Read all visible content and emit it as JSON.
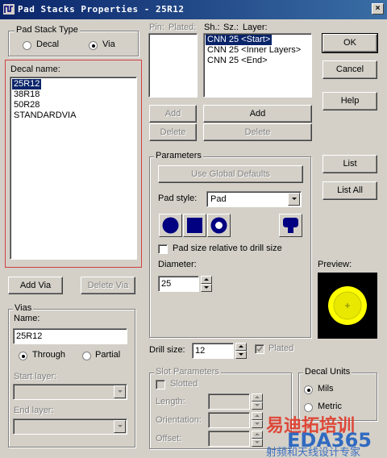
{
  "window": {
    "title": "Pad Stacks Properties - 25R12",
    "close_glyph": "×"
  },
  "pad_stack_type": {
    "group_label": "Pad Stack Type",
    "options": [
      {
        "label": "Decal",
        "selected": false
      },
      {
        "label": "Via",
        "selected": true
      }
    ]
  },
  "decal": {
    "label": "Decal name:",
    "items": [
      {
        "label": "25R12",
        "selected": true
      },
      {
        "label": "38R18"
      },
      {
        "label": "50R28"
      },
      {
        "label": "STANDARDVIA"
      }
    ],
    "highlight_color": "#d04040"
  },
  "buttons": {
    "add_via": "Add Via",
    "delete_via": "Delete Via",
    "ok": "OK",
    "cancel": "Cancel",
    "help": "Help",
    "add_left": "Add",
    "delete_left": "Delete",
    "add_right": "Add",
    "delete_right": "Delete",
    "list": "List",
    "list_all": "List All",
    "use_global_defaults": "Use Global Defaults"
  },
  "vias": {
    "group_label": "Vias",
    "name_label": "Name:",
    "name_value": "25R12",
    "through_label": "Through",
    "partial_label": "Partial",
    "start_layer_label": "Start layer:",
    "end_layer_label": "End layer:"
  },
  "pin_header": {
    "pin": "Pin:",
    "plated": "Plated:"
  },
  "layer_header": {
    "sh": "Sh.:",
    "sz": "Sz.:",
    "layer": "Layer:"
  },
  "layers": [
    {
      "label": "CNN 25 <Start>",
      "selected": true
    },
    {
      "label": "CNN 25 <Inner Layers>"
    },
    {
      "label": "CNN 25 <End>"
    }
  ],
  "parameters": {
    "group_label": "Parameters",
    "pad_style_label": "Pad style:",
    "pad_style_value": "Pad",
    "pad_size_relative_label": "Pad size relative to drill size",
    "diameter_label": "Diameter:",
    "diameter_value": "25",
    "shape_color": "#000080",
    "shape_icons": [
      "round-pad-icon",
      "square-pad-icon",
      "annular-pad-icon",
      "odd-shape-pad-icon"
    ]
  },
  "drill": {
    "label": "Drill size:",
    "value": "12",
    "plated_label": "Plated",
    "plated_checked": true
  },
  "slot": {
    "group_label": "Slot Parameters",
    "slotted_label": "Slotted",
    "length_label": "Length:",
    "orientation_label": "Orientation:",
    "offset_label": "Offset:"
  },
  "decal_units": {
    "group_label": "Decal Units",
    "mils_label": "Mils",
    "metric_label": "Metric",
    "mils_selected": true
  },
  "preview": {
    "label": "Preview:",
    "background": "#000000",
    "pad_color": "#ffff00",
    "outline_color": "#e0e000"
  },
  "watermark": {
    "line1": "易迪拓培训",
    "line2": "EDA365",
    "line3": "射频和天线设计专家",
    "color": "#2060c0",
    "accent": "#e03020"
  }
}
